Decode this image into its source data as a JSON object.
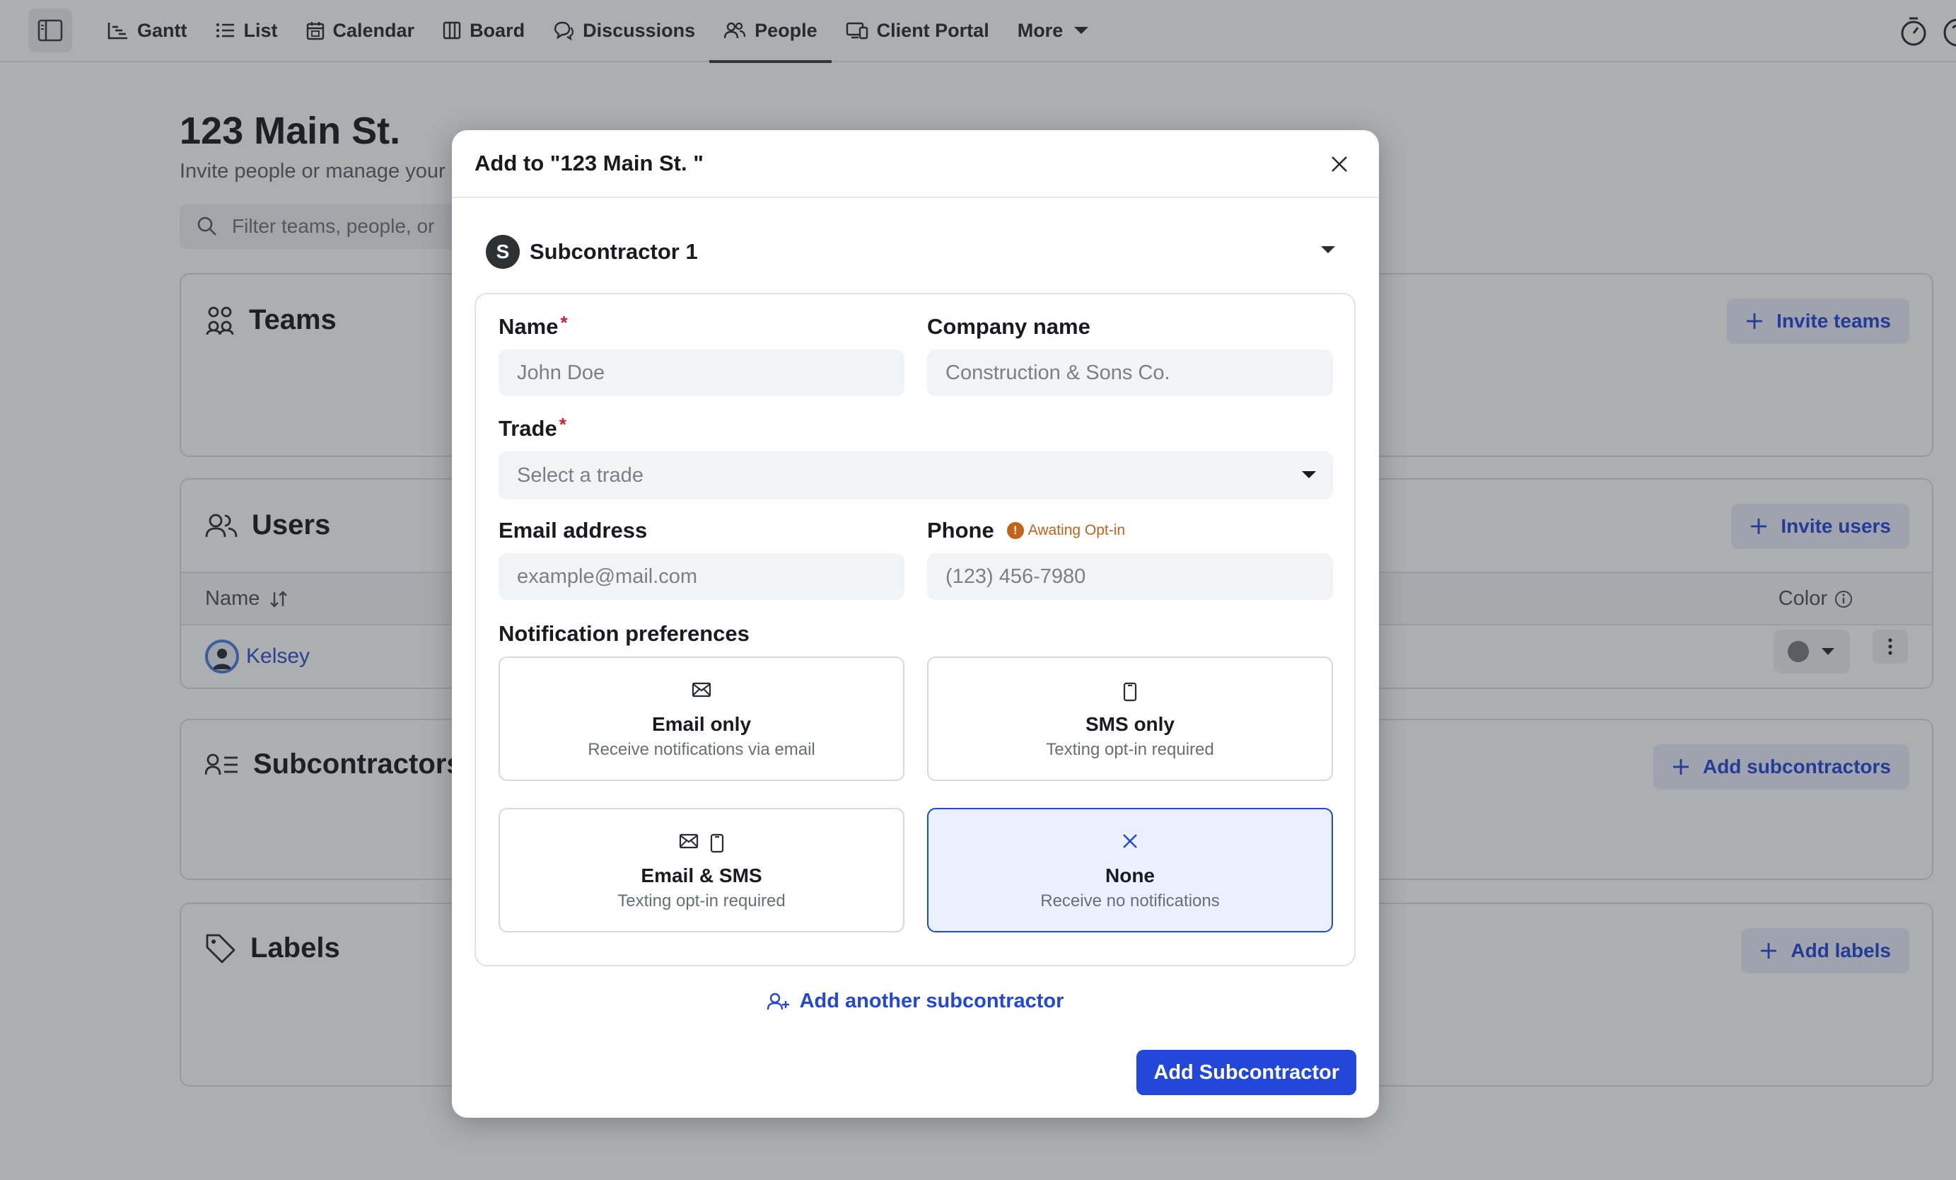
{
  "nav": {
    "tabs": [
      {
        "label": "Gantt",
        "icon": "gantt-icon"
      },
      {
        "label": "List",
        "icon": "list-icon"
      },
      {
        "label": "Calendar",
        "icon": "calendar-icon"
      },
      {
        "label": "Board",
        "icon": "board-icon"
      },
      {
        "label": "Discussions",
        "icon": "discussions-icon"
      },
      {
        "label": "People",
        "icon": "people-icon",
        "active": true
      },
      {
        "label": "Client Portal",
        "icon": "client-portal-icon"
      },
      {
        "label": "More",
        "icon": "chevron-down-icon"
      }
    ]
  },
  "page": {
    "title": "123 Main St.",
    "subtitle": "Invite people or manage your",
    "filter_placeholder": "Filter teams, people, or",
    "cards": {
      "teams": {
        "title": "Teams",
        "button": "Invite teams"
      },
      "users": {
        "title": "Users",
        "button": "Invite users",
        "col_name": "Name",
        "col_color": "Color",
        "rows": [
          {
            "name": "Kelsey",
            "color": "#7b7d82"
          }
        ]
      },
      "subcontractors": {
        "title": "Subcontractors",
        "button": "Add subcontractors"
      },
      "labels": {
        "title": "Labels",
        "button": "Add labels"
      }
    }
  },
  "modal": {
    "title": "Add to \"123 Main St. \"",
    "subcontractor": {
      "badge": "S",
      "name": "Subcontractor 1"
    },
    "fields": {
      "name_label": "Name",
      "name_placeholder": "John Doe",
      "company_label": "Company name",
      "company_placeholder": "Construction & Sons Co.",
      "trade_label": "Trade",
      "trade_placeholder": "Select a trade",
      "email_label": "Email address",
      "email_placeholder": "example@mail.com",
      "phone_label": "Phone",
      "phone_status": "Awating Opt-in",
      "phone_placeholder": "(123) 456-7980",
      "required_mark": "*"
    },
    "preferences": {
      "label": "Notification preferences",
      "options": [
        {
          "title": "Email only",
          "desc": "Receive notifications via email"
        },
        {
          "title": "SMS only",
          "desc": "Texting opt-in required"
        },
        {
          "title": "Email & SMS",
          "desc": "Texting opt-in required"
        },
        {
          "title": "None",
          "desc": "Receive no notifications",
          "selected": true
        }
      ]
    },
    "add_another": "Add another subcontractor",
    "submit": "Add Subcontractor"
  },
  "colors": {
    "accent": "#2347d8",
    "selected_bg": "#eaf0fd",
    "warning": "#c3621a",
    "required": "#d0212f"
  }
}
